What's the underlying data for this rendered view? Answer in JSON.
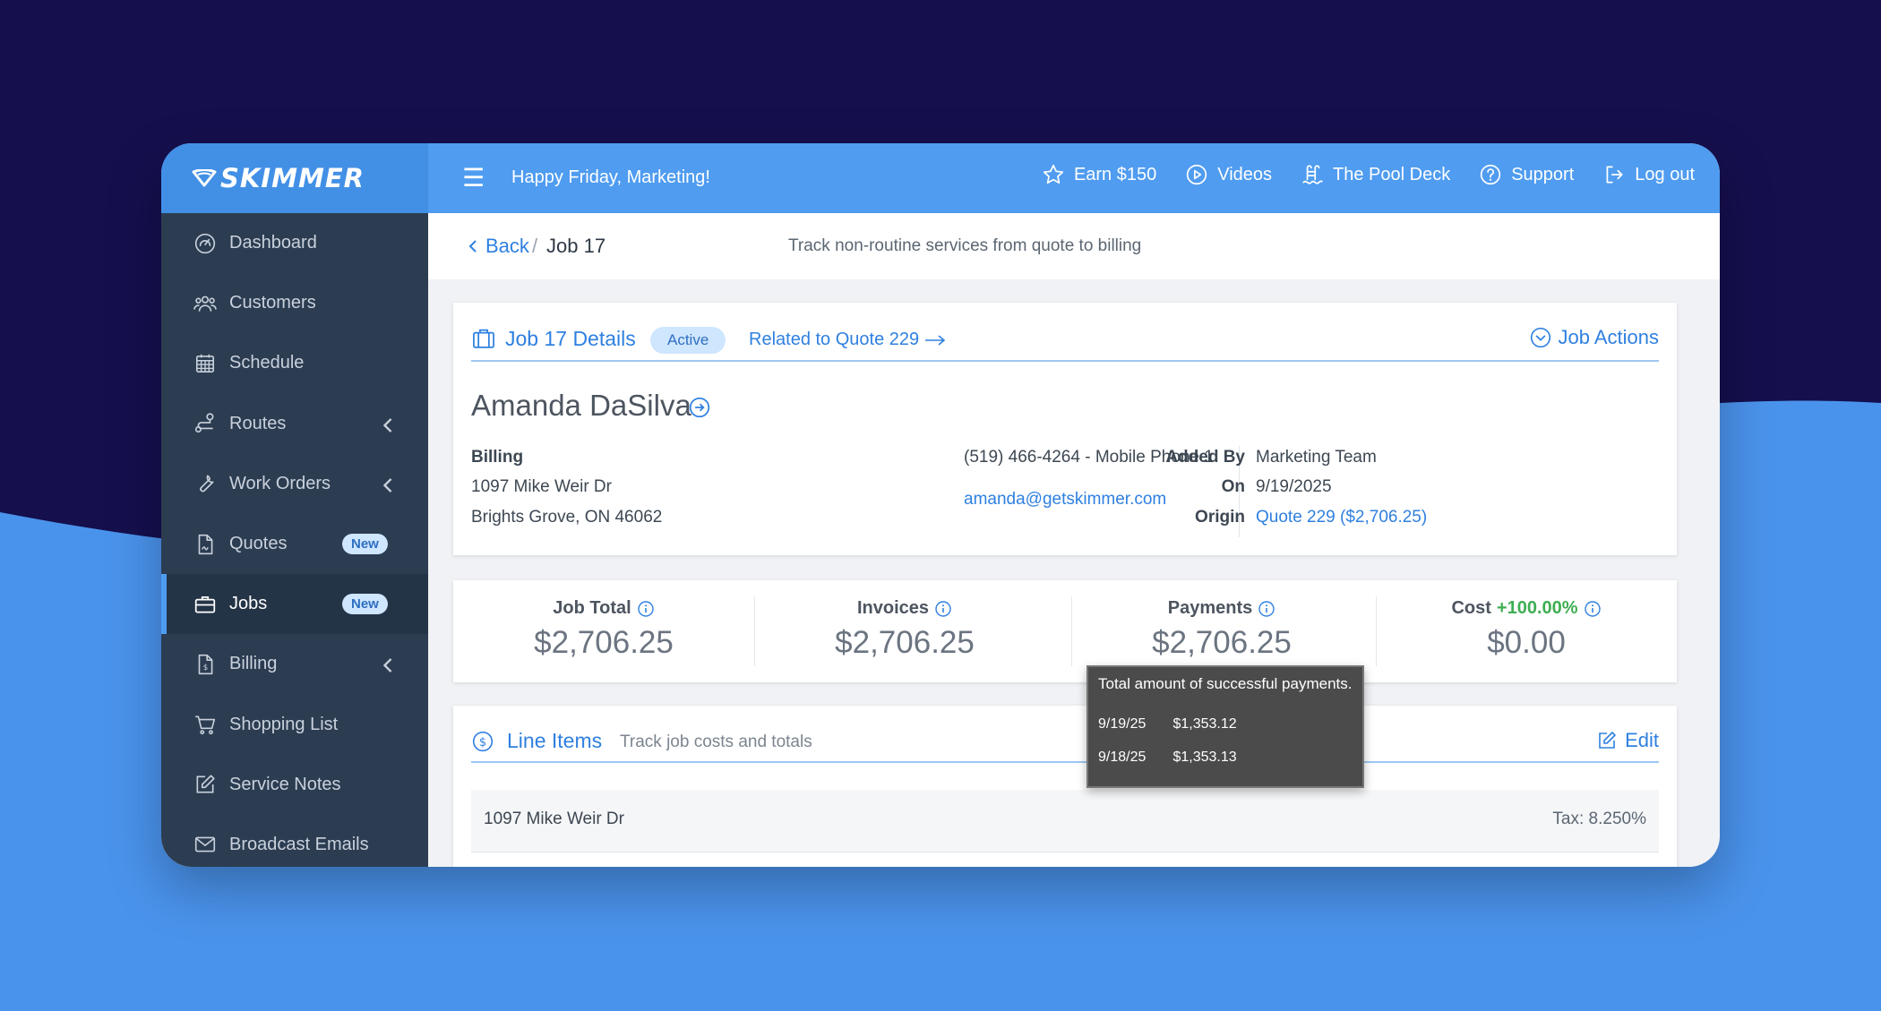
{
  "brand": {
    "name": "SKIMMER"
  },
  "topbar": {
    "greeting": "Happy Friday, Marketing!",
    "nav": [
      {
        "label": "Earn $150",
        "icon": "star-icon"
      },
      {
        "label": "Videos",
        "icon": "play-icon"
      },
      {
        "label": "The Pool Deck",
        "icon": "pool-ladder-icon"
      },
      {
        "label": "Support",
        "icon": "help-icon"
      },
      {
        "label": "Log out",
        "icon": "logout-icon"
      }
    ]
  },
  "sidebar": {
    "items": [
      {
        "label": "Dashboard",
        "icon": "gauge-icon"
      },
      {
        "label": "Customers",
        "icon": "users-icon"
      },
      {
        "label": "Schedule",
        "icon": "calendar-icon"
      },
      {
        "label": "Routes",
        "icon": "route-icon",
        "expandable": true
      },
      {
        "label": "Work Orders",
        "icon": "wrench-icon",
        "expandable": true
      },
      {
        "label": "Quotes",
        "icon": "document-icon",
        "badge": "New"
      },
      {
        "label": "Jobs",
        "icon": "briefcase-icon",
        "badge": "New",
        "active": true
      },
      {
        "label": "Billing",
        "icon": "invoice-icon",
        "expandable": true
      },
      {
        "label": "Shopping List",
        "icon": "cart-icon"
      },
      {
        "label": "Service Notes",
        "icon": "note-edit-icon"
      },
      {
        "label": "Broadcast Emails",
        "icon": "envelope-icon"
      }
    ]
  },
  "header": {
    "back_label": "Back",
    "separator": "/",
    "current": "Job 17",
    "subtitle": "Track non-routine services from quote to billing"
  },
  "details": {
    "title": "Job 17 Details",
    "status": "Active",
    "related_quote": "Related to Quote 229",
    "actions_label": "Job Actions",
    "customer_name": "Amanda DaSilva",
    "billing_label": "Billing",
    "billing_line1": "1097 Mike Weir Dr",
    "billing_line2": "Brights Grove, ON 46062",
    "phone": "(519) 466-4264 - Mobile Phone 1",
    "email": "amanda@getskimmer.com",
    "added_by_label": "Added By",
    "added_by": "Marketing Team",
    "on_label": "On",
    "on_date": "9/19/2025",
    "origin_label": "Origin",
    "origin": "Quote 229 ($2,706.25)"
  },
  "stats": [
    {
      "label": "Job Total",
      "value": "$2,706.25"
    },
    {
      "label": "Invoices",
      "value": "$2,706.25"
    },
    {
      "label": "Payments",
      "value": "$2,706.25"
    },
    {
      "label": "Cost",
      "pct": "+100.00%",
      "value": "$0.00"
    }
  ],
  "tooltip": {
    "heading": "Total amount of successful payments.",
    "rows": [
      {
        "date": "9/19/25",
        "amount": "$1,353.12"
      },
      {
        "date": "9/18/25",
        "amount": "$1,353.13"
      }
    ]
  },
  "line_items": {
    "title": "Line Items",
    "subtitle": "Track job costs and totals",
    "edit_label": "Edit",
    "address": "1097 Mike Weir Dr",
    "tax": "Tax: 8.250%"
  },
  "colors": {
    "accent": "#4f9cf0",
    "sidebar": "#2c3d52",
    "background_top": "#150f4e",
    "background_wave": "#4a93ec",
    "positive": "#3fae52"
  }
}
